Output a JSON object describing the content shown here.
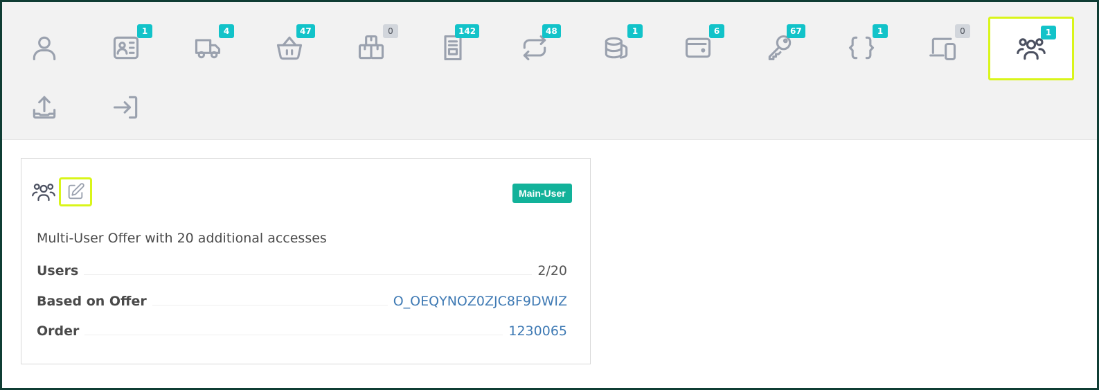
{
  "tabs": [
    {
      "id": "profile",
      "icon": "user-icon",
      "badge": null
    },
    {
      "id": "id-card",
      "icon": "id-card-icon",
      "badge": "1"
    },
    {
      "id": "shipping",
      "icon": "truck-icon",
      "badge": "4"
    },
    {
      "id": "basket",
      "icon": "basket-icon",
      "badge": "47"
    },
    {
      "id": "packages",
      "icon": "packages-icon",
      "badge": "0"
    },
    {
      "id": "invoices",
      "icon": "invoice-icon",
      "badge": "142"
    },
    {
      "id": "subscriptions",
      "icon": "repeat-icon",
      "badge": "48"
    },
    {
      "id": "credits",
      "icon": "coins-icon",
      "badge": "1"
    },
    {
      "id": "wallet",
      "icon": "wallet-icon",
      "badge": "6"
    },
    {
      "id": "keys",
      "icon": "key-icon",
      "badge": "67"
    },
    {
      "id": "api",
      "icon": "braces-icon",
      "badge": "1"
    },
    {
      "id": "devices",
      "icon": "devices-icon",
      "badge": "0"
    },
    {
      "id": "multi-user",
      "icon": "users-icon",
      "badge": "1",
      "active": true
    },
    {
      "id": "upload",
      "icon": "upload-icon",
      "badge": null
    },
    {
      "id": "login-as",
      "icon": "sign-in-icon",
      "badge": null
    }
  ],
  "card": {
    "icon": "users-icon",
    "edit_icon": "edit-icon",
    "badge": "Main-User",
    "title": "Multi-User Offer with 20 additional accesses",
    "rows": [
      {
        "label": "Users",
        "value": "2/20",
        "link": false
      },
      {
        "label": "Based on Offer",
        "value": "O_OEQYNOZ0ZJC8F9DWIZ",
        "link": true
      },
      {
        "label": "Order",
        "value": "1230065",
        "link": true
      }
    ]
  },
  "colors": {
    "badge_teal": "#12c3c9",
    "badge_zero": "#d2d6dc",
    "main_user_badge": "#12b29a",
    "highlight": "#d9f51a",
    "link": "#3f7ab4",
    "frame": "#0f3d34"
  }
}
